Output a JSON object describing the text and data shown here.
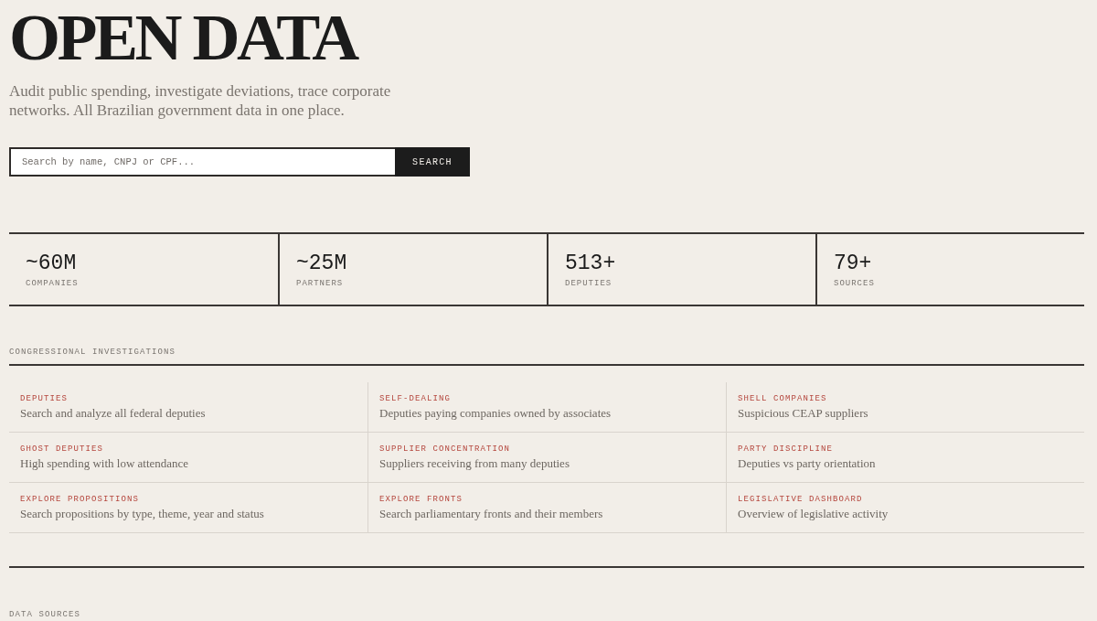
{
  "hero": {
    "title": "OPEN DATA",
    "subtitle": "Audit public spending, investigate deviations, trace corporate networks. All Brazilian government data in one place."
  },
  "search": {
    "placeholder": "Search by name, CNPJ or CPF...",
    "button": "SEARCH"
  },
  "stats": [
    {
      "value": "~60M",
      "label": "COMPANIES"
    },
    {
      "value": "~25M",
      "label": "PARTNERS"
    },
    {
      "value": "513+",
      "label": "DEPUTIES"
    },
    {
      "value": "79+",
      "label": "SOURCES"
    }
  ],
  "investigations": {
    "heading": "CONGRESSIONAL INVESTIGATIONS",
    "items": [
      {
        "title": "DEPUTIES",
        "description": "Search and analyze all federal deputies"
      },
      {
        "title": "SELF-DEALING",
        "description": "Deputies paying companies owned by associates"
      },
      {
        "title": "SHELL COMPANIES",
        "description": "Suspicious CEAP suppliers"
      },
      {
        "title": "GHOST DEPUTIES",
        "description": "High spending with low attendance"
      },
      {
        "title": "SUPPLIER CONCENTRATION",
        "description": "Suppliers receiving from many deputies"
      },
      {
        "title": "PARTY DISCIPLINE",
        "description": "Deputies vs party orientation"
      },
      {
        "title": "EXPLORE PROPOSITIONS",
        "description": "Search propositions by type, theme, year and status"
      },
      {
        "title": "EXPLORE FRONTS",
        "description": "Search parliamentary fronts and their members"
      },
      {
        "title": "LEGISLATIVE DASHBOARD",
        "description": "Overview of legislative activity"
      }
    ]
  },
  "data_sources": {
    "heading": "DATA SOURCES"
  }
}
